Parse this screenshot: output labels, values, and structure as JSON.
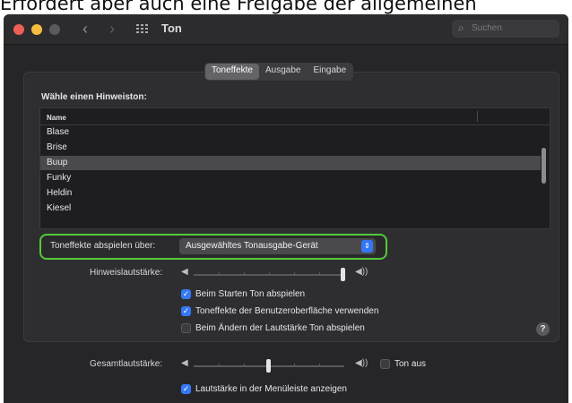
{
  "caption": "Erfordert aber auch eine Freigabe der allgemeinen",
  "window": {
    "title": "Ton",
    "search_placeholder": "Suchen",
    "back_glyph": "‹",
    "forward_glyph": "›"
  },
  "tabs": [
    {
      "label": "Toneffekte",
      "active": true
    },
    {
      "label": "Ausgabe",
      "active": false
    },
    {
      "label": "Eingabe",
      "active": false
    }
  ],
  "alert_section": {
    "heading": "Wähle einen Hinweiston:",
    "column_header": "Name",
    "sounds": [
      "Blase",
      "Brise",
      "Buup",
      "Funky",
      "Heldin",
      "Kiesel"
    ],
    "selected": "Buup"
  },
  "output": {
    "label": "Toneffekte abspielen über:",
    "selected_device": "Ausgewähltes Tonausgabe-Gerät"
  },
  "alert_volume": {
    "label": "Hinweislautstärke:",
    "level": 1.0
  },
  "options": [
    {
      "label": "Beim Starten Ton abspielen",
      "checked": true
    },
    {
      "label": "Toneffekte der Benutzeroberfläche verwenden",
      "checked": true
    },
    {
      "label": "Beim Ändern der Lautstärke Ton abspielen",
      "checked": false
    }
  ],
  "output_volume": {
    "label": "Gesamtlautstärke:",
    "level": 0.5
  },
  "mute": {
    "label": "Ton aus",
    "checked": false
  },
  "menubar_option": {
    "label": "Lautstärke in der Menüleiste anzeigen",
    "checked": true
  },
  "help_glyph": "?",
  "colors": {
    "accent": "#3478f6",
    "highlight_border": "#55c93a",
    "window_bg": "#262628"
  }
}
